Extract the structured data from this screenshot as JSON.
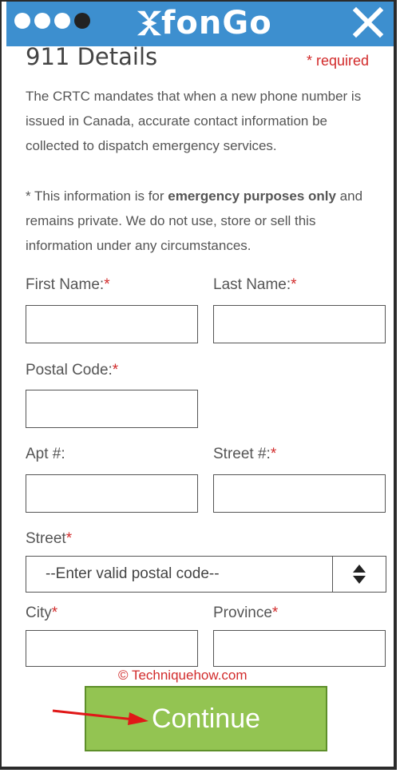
{
  "header": {
    "logo_text": "fonGo",
    "colors": {
      "bar": "#3d8fcf",
      "accent_red": "#d22b2b",
      "button_green": "#93c452"
    }
  },
  "form": {
    "title": "911 Details",
    "required_note": "* required",
    "intro_lines": [
      "The CRTC mandates that when a new phone number is",
      "issued in Canada, accurate contact information be",
      "collected to dispatch emergency services."
    ],
    "privacy_prefix": "* This information is for ",
    "privacy_bold": "emergency purposes only",
    "privacy_suffix": " and",
    "privacy_lines": [
      "remains private. We do not use, store or sell this",
      "information under any circumstances."
    ],
    "fields": {
      "first_name": {
        "label": "First Name:",
        "value": ""
      },
      "last_name": {
        "label": "Last Name:",
        "value": ""
      },
      "postal_code": {
        "label": "Postal Code:",
        "value": ""
      },
      "apt": {
        "label": "Apt #:",
        "value": ""
      },
      "street_num": {
        "label": "Street #:",
        "value": ""
      },
      "street": {
        "label": "Street",
        "selected": "--Enter valid postal code--"
      },
      "city": {
        "label": "City",
        "value": ""
      },
      "province": {
        "label": "Province",
        "value": ""
      }
    },
    "required_star": "*",
    "continue_label": "Continue"
  },
  "watermark": "© Techniquehow.com"
}
